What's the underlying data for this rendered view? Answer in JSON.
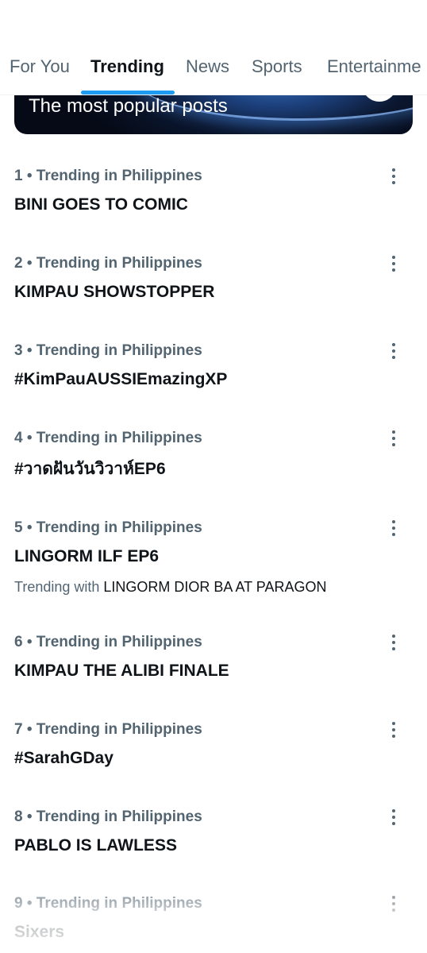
{
  "tabs": [
    {
      "label": "For You"
    },
    {
      "label": "Trending"
    },
    {
      "label": "News"
    },
    {
      "label": "Sports"
    },
    {
      "label": "Entertainme"
    }
  ],
  "active_tab": "Trending",
  "banner": {
    "title": "The most popular posts"
  },
  "colors": {
    "accent": "#1d9bf0",
    "secondary_text": "#536471",
    "primary_text": "#0f1419"
  },
  "trends": [
    {
      "meta": "1 • Trending in Philippines",
      "name": "BINI GOES TO COMIC"
    },
    {
      "meta": "2 • Trending in Philippines",
      "name": "KIMPAU SHOWSTOPPER"
    },
    {
      "meta": "3 • Trending in Philippines",
      "name": "#KimPauAUSSIEmazingXP"
    },
    {
      "meta": "4 • Trending in Philippines",
      "name": "#วาดฝันวันวิวาห์EP6"
    },
    {
      "meta": "5 • Trending in Philippines",
      "name": "LINGORM ILF EP6",
      "trending_with_label": "Trending with",
      "trending_with_topic": "LINGORM DIOR BA AT PARAGON"
    },
    {
      "meta": "6 • Trending in Philippines",
      "name": "KIMPAU THE ALIBI FINALE"
    },
    {
      "meta": "7 • Trending in Philippines",
      "name": "#SarahGDay"
    },
    {
      "meta": "8 • Trending in Philippines",
      "name": "PABLO IS LAWLESS"
    },
    {
      "meta": "9 • Trending in Philippines",
      "name": "Sixers"
    }
  ]
}
